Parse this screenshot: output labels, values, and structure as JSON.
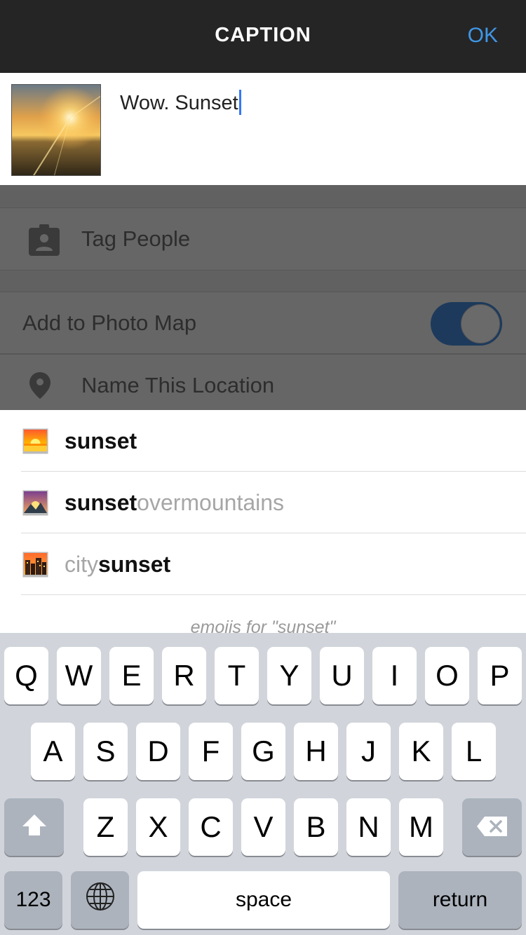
{
  "header": {
    "title": "CAPTION",
    "ok_label": "OK"
  },
  "caption": {
    "text": "Wow. Sunset"
  },
  "options": {
    "tag_people_label": "Tag People",
    "photo_map_label": "Add to Photo Map",
    "photo_map_enabled": true,
    "location_label": "Name This Location"
  },
  "suggestions": {
    "items": [
      {
        "emoji": "sunset",
        "bold": "sunset",
        "light": ""
      },
      {
        "emoji": "sunrise-over-mountains",
        "bold": "sunset",
        "light": "overmountains"
      },
      {
        "emoji": "city-sunset",
        "prefix": "city",
        "bold": "sunset"
      }
    ],
    "note": "emojis for \"sunset\""
  },
  "keyboard": {
    "row1": [
      "Q",
      "W",
      "E",
      "R",
      "T",
      "Y",
      "U",
      "I",
      "O",
      "P"
    ],
    "row2": [
      "A",
      "S",
      "D",
      "F",
      "G",
      "H",
      "J",
      "K",
      "L"
    ],
    "row3": [
      "Z",
      "X",
      "C",
      "V",
      "B",
      "N",
      "M"
    ],
    "numbers_label": "123",
    "space_label": "space",
    "return_label": "return"
  },
  "colors": {
    "accent": "#3f97e5",
    "header_bg": "#252526",
    "keyboard_bg": "#d1d5db"
  }
}
